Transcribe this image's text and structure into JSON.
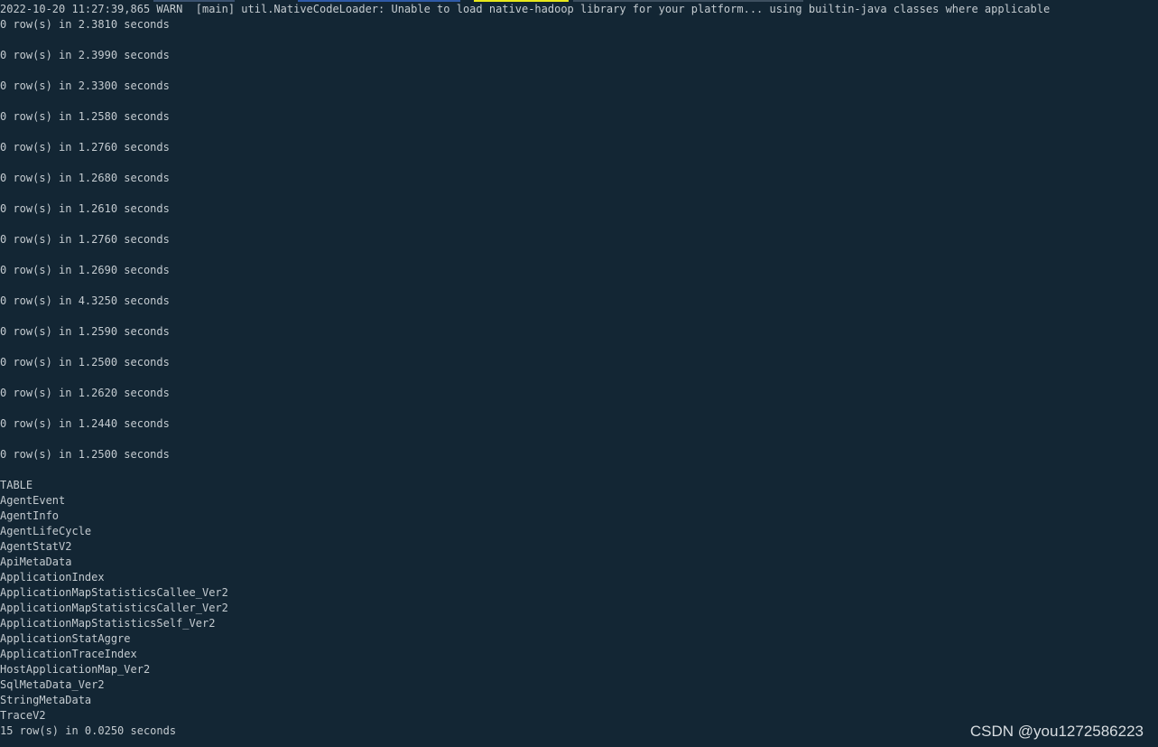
{
  "warn_line": "2022-10-20 11:27:39,865 WARN  [main] util.NativeCodeLoader: Unable to load native-hadoop library for your platform... using builtin-java classes where applicable",
  "create_results": [
    "0 row(s) in 2.3810 seconds",
    "0 row(s) in 2.3990 seconds",
    "0 row(s) in 2.3300 seconds",
    "0 row(s) in 1.2580 seconds",
    "0 row(s) in 1.2760 seconds",
    "0 row(s) in 1.2680 seconds",
    "0 row(s) in 1.2610 seconds",
    "0 row(s) in 1.2760 seconds",
    "0 row(s) in 1.2690 seconds",
    "0 row(s) in 4.3250 seconds",
    "0 row(s) in 1.2590 seconds",
    "0 row(s) in 1.2500 seconds",
    "0 row(s) in 1.2620 seconds",
    "0 row(s) in 1.2440 seconds",
    "0 row(s) in 1.2500 seconds"
  ],
  "table_header": "TABLE",
  "tables": [
    "AgentEvent",
    "AgentInfo",
    "AgentLifeCycle",
    "AgentStatV2",
    "ApiMetaData",
    "ApplicationIndex",
    "ApplicationMapStatisticsCallee_Ver2",
    "ApplicationMapStatisticsCaller_Ver2",
    "ApplicationMapStatisticsSelf_Ver2",
    "ApplicationStatAggre",
    "ApplicationTraceIndex",
    "HostApplicationMap_Ver2",
    "SqlMetaData_Ver2",
    "StringMetaData",
    "TraceV2"
  ],
  "list_summary": "15 row(s) in 0.0250 seconds",
  "watermark": "CSDN @you1272586223",
  "colors": {
    "background": "#132634",
    "text": "#c4cbd0"
  }
}
